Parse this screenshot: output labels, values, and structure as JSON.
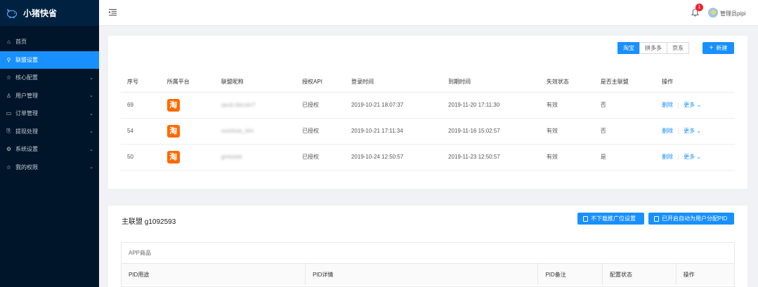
{
  "app": {
    "title": "小猪快省"
  },
  "sidebar": {
    "items": [
      {
        "label": "首页",
        "icon": "home-icon",
        "has_arrow": false,
        "active": false
      },
      {
        "label": "联盟设置",
        "icon": "alliance-icon",
        "has_arrow": false,
        "active": true
      },
      {
        "label": "核心配置",
        "icon": "star-icon",
        "has_arrow": true,
        "active": false
      },
      {
        "label": "用户管理",
        "icon": "user-icon",
        "has_arrow": true,
        "active": false
      },
      {
        "label": "订单管理",
        "icon": "order-icon",
        "has_arrow": true,
        "active": false
      },
      {
        "label": "提现处理",
        "icon": "withdraw-icon",
        "has_arrow": true,
        "active": false
      },
      {
        "label": "系统设置",
        "icon": "gear-icon",
        "has_arrow": true,
        "active": false
      },
      {
        "label": "我的权限",
        "icon": "star-icon",
        "has_arrow": true,
        "active": false
      }
    ]
  },
  "header": {
    "notification_count": "1",
    "username": "管理员pipi"
  },
  "platform_tabs": [
    "淘宝",
    "拼多多",
    "京东"
  ],
  "new_button": "新建",
  "alliance_table": {
    "columns": [
      "序号",
      "所属平台",
      "联盟昵称",
      "授权API",
      "登录时间",
      "到期时间",
      "失效状态",
      "是否主联盟",
      "操作"
    ],
    "rows": [
      {
        "id": "69",
        "platform": "淘",
        "nickname": "qaub.ilaicain?",
        "api": "已授权",
        "login": "2019-10-21 18:07:37",
        "expire": "2019-11-20 17:11:30",
        "status": "有效",
        "main": "否",
        "delete": "删除",
        "more": "更多"
      },
      {
        "id": "54",
        "platform": "淘",
        "nickname": "ouiotiuia_tiim",
        "api": "已授权",
        "login": "2019-10-21 17:11:34",
        "expire": "2019-11-16 15:02:57",
        "status": "有效",
        "main": "否",
        "delete": "删除",
        "more": "更多"
      },
      {
        "id": "50",
        "platform": "淘",
        "nickname": "gmlutsbi",
        "api": "已授权",
        "login": "2019-10-24 12:50:57",
        "expire": "2019-11-23 12:50:57",
        "status": "有效",
        "main": "是",
        "delete": "删除",
        "more": "更多"
      }
    ]
  },
  "main_alliance": {
    "title": "主联盟 g1092593",
    "btn_no_download": "不下载推广位设置",
    "btn_auto_assign": "已开启自动为用户分配PID",
    "section_title": "APP商品",
    "columns": [
      "PID用途",
      "PID详情",
      "PID备注",
      "配置状态",
      "操作"
    ]
  },
  "colors": {
    "primary": "#1890ff",
    "sidebar_bg": "#001529",
    "taobao": "#ff6a00",
    "yes": "#52c41a"
  }
}
